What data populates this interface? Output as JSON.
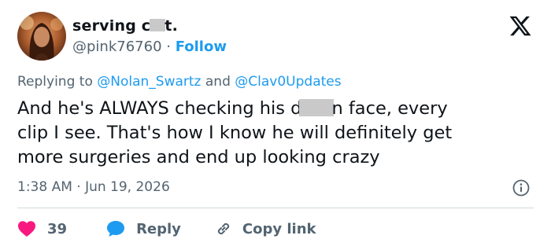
{
  "author": {
    "display_name_start": "serving c",
    "display_name_end": "t.",
    "handle": "@pink76760",
    "separator": " · ",
    "follow_label": "Follow"
  },
  "reply_context": {
    "prefix": "Replying to ",
    "mention_1": "@Nolan_Swartz",
    "conjunction": " and ",
    "mention_2": "@Clav0Updates"
  },
  "tweet": {
    "line1_start": "And he's ALWAYS checking his d",
    "line1_end": "n face, every",
    "line2": "clip I see. That's how I know he will definitely get",
    "line3": "more surgeries and end up looking crazy"
  },
  "timestamp": "1:38 AM · Jun 19, 2026",
  "actions": {
    "like_count": "39",
    "reply_label": "Reply",
    "copy_label": "Copy link"
  },
  "icons": {
    "platform_logo": "x-logo-icon",
    "info": "info-icon",
    "like": "heart-icon",
    "reply": "speech-bubble-icon",
    "copy": "link-icon"
  },
  "colors": {
    "accent": "#1d9bf0",
    "like": "#f91880",
    "muted_text": "#536471",
    "text": "#0f1419"
  }
}
